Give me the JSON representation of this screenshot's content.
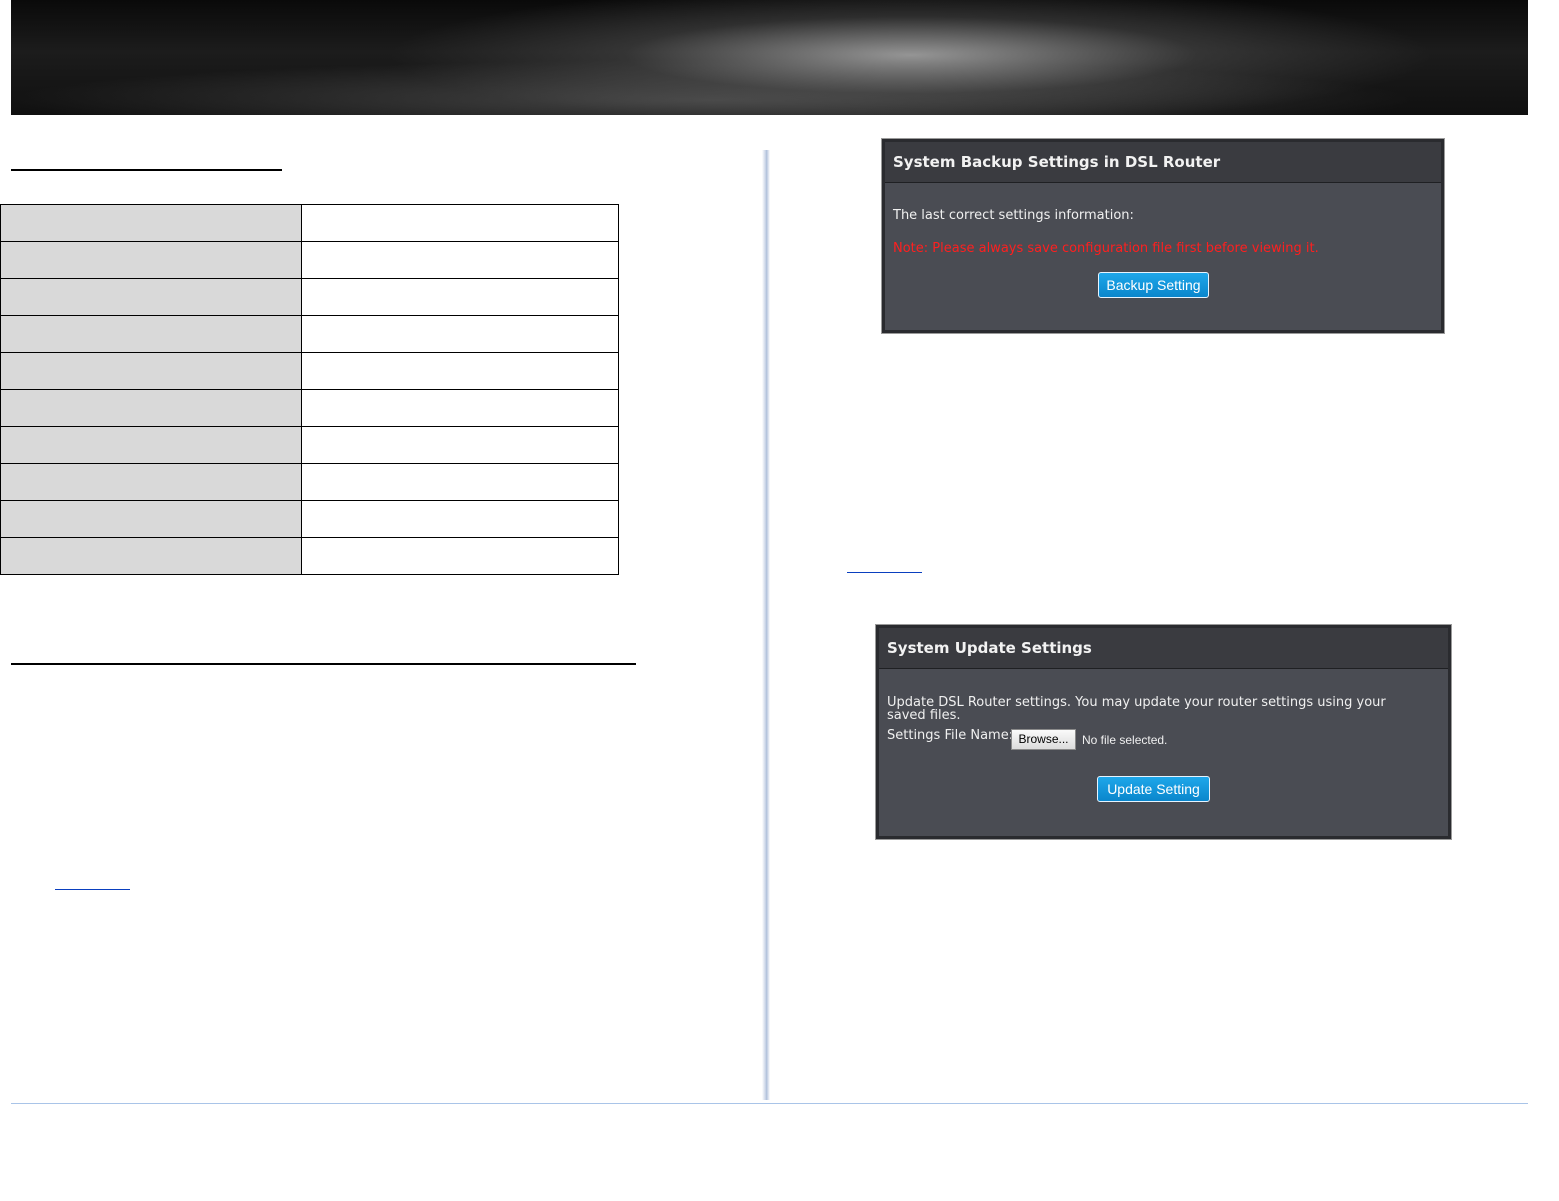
{
  "backup_panel": {
    "title": "System Backup Settings in DSL Router",
    "info_label": "The last correct settings information:",
    "note": "Note: Please always save configuration file first before viewing it.",
    "button_label": "Backup Setting"
  },
  "update_panel": {
    "title": "System Update Settings",
    "description": "Update DSL Router settings. You may update your router settings using your saved files.",
    "file_label": "Settings File Name:",
    "browse_label": "Browse...",
    "file_status": "No file selected.",
    "button_label": "Update Setting"
  },
  "colors": {
    "panel_bg": "#4a4c53",
    "note_red": "#ff1f1f",
    "button_blue": "#0a86cc",
    "table_key_bg": "#d9d9d9"
  }
}
